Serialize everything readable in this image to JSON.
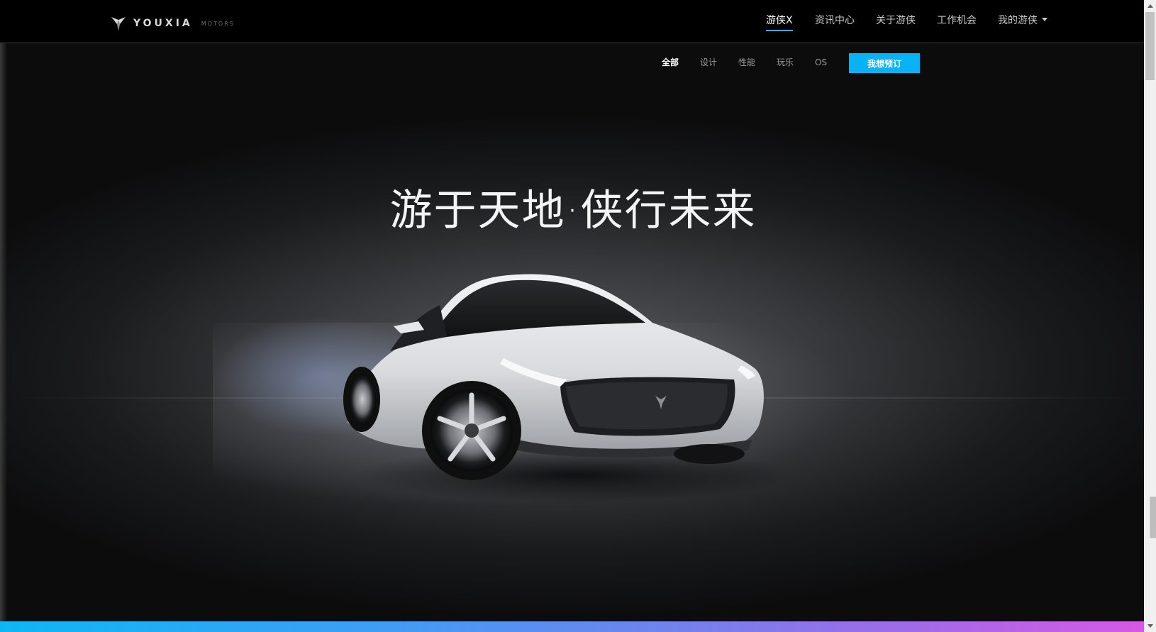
{
  "header": {
    "logo": {
      "icon": "youxia-logo-icon",
      "word": "YOUXIA",
      "sub": "MOTORS"
    },
    "nav": [
      {
        "label": "游侠X",
        "active": true
      },
      {
        "label": "资讯中心",
        "active": false
      },
      {
        "label": "关于游侠",
        "active": false
      },
      {
        "label": "工作机会",
        "active": false
      },
      {
        "label": "我的游侠",
        "active": false,
        "dropdown": true
      }
    ]
  },
  "sub_nav": {
    "items": [
      {
        "label": "全部",
        "active": true
      },
      {
        "label": "设计",
        "active": false
      },
      {
        "label": "性能",
        "active": false
      },
      {
        "label": "玩乐",
        "active": false
      },
      {
        "label": "OS",
        "active": false
      }
    ],
    "order_button": "我想预订"
  },
  "hero": {
    "headline": "游于天地·侠行未来",
    "image": "white-electric-sedan-car-image"
  },
  "colors": {
    "accent": "#09b2f5",
    "background": "#000000",
    "bottom_gradient": [
      "#10b6f4",
      "#6a86ee",
      "#d65ae3"
    ]
  }
}
